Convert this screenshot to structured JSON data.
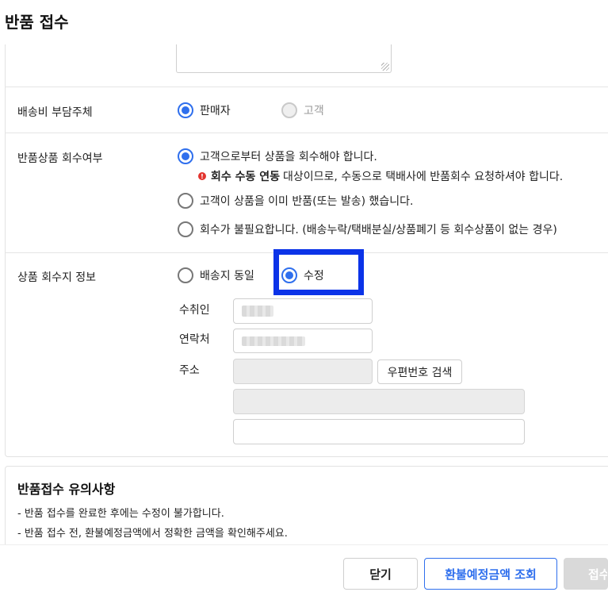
{
  "window": {
    "title": "반품 접수"
  },
  "shipping_fee": {
    "label": "배송비 부담주체",
    "options": [
      {
        "label": "판매자",
        "selected": true,
        "disabled": false
      },
      {
        "label": "고객",
        "selected": false,
        "disabled": true
      }
    ]
  },
  "collect": {
    "label": "반품상품 회수여부",
    "options": [
      {
        "label": "고객으로부터 상품을 회수해야 합니다.",
        "selected": true
      },
      {
        "label": "고객이 상품을 이미 반품(또는 발송) 했습니다.",
        "selected": false
      },
      {
        "label": "회수가 불필요합니다. (배송누락/택배분실/상품폐기 등 회수상품이 없는 경우)",
        "selected": false
      }
    ],
    "notice_bold": "회수 수동 연동",
    "notice_text": "대상이므로, 수동으로 택배사에 반품회수 요청하셔야 합니다."
  },
  "pickup": {
    "label": "상품 회수지 정보",
    "options": [
      {
        "label": "배송지 동일",
        "selected": false
      },
      {
        "label": "수정",
        "selected": true
      }
    ],
    "fields": {
      "recipient_label": "수취인",
      "contact_label": "연락처",
      "address_label": "주소",
      "zip_search_label": "우편번호 검색"
    }
  },
  "notes": {
    "title": "반품접수 유의사항",
    "lines": [
      "- 반품 접수를 완료한 후에는 수정이 불가합니다.",
      "- 반품 접수 전, 환불예정금액에서 정확한 금액을 확인해주세요."
    ]
  },
  "footer": {
    "close_label": "닫기",
    "refund_label": "환불예정금액 조회",
    "submit_label": "접수"
  },
  "colors": {
    "accent": "#2f6fed",
    "highlight": "#0b33e8",
    "warning": "#e3342f"
  }
}
